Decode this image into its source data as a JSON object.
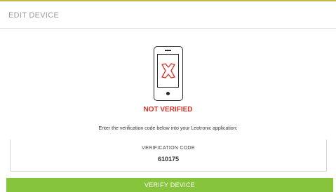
{
  "header": {
    "title": "EDIT DEVICE",
    "accent_color": "#c7b84a"
  },
  "device": {
    "icon": "phone-not-verified-icon",
    "status": "NOT VERIFIED",
    "status_color": "#d9322b"
  },
  "verification": {
    "instruction": "Enter the verification code below into your Leotronic application:",
    "code_label": "VERIFICATION CODE",
    "code_value": "610175"
  },
  "actions": {
    "verify_label": "VERIFY DEVICE",
    "verify_color": "#86c43b"
  }
}
